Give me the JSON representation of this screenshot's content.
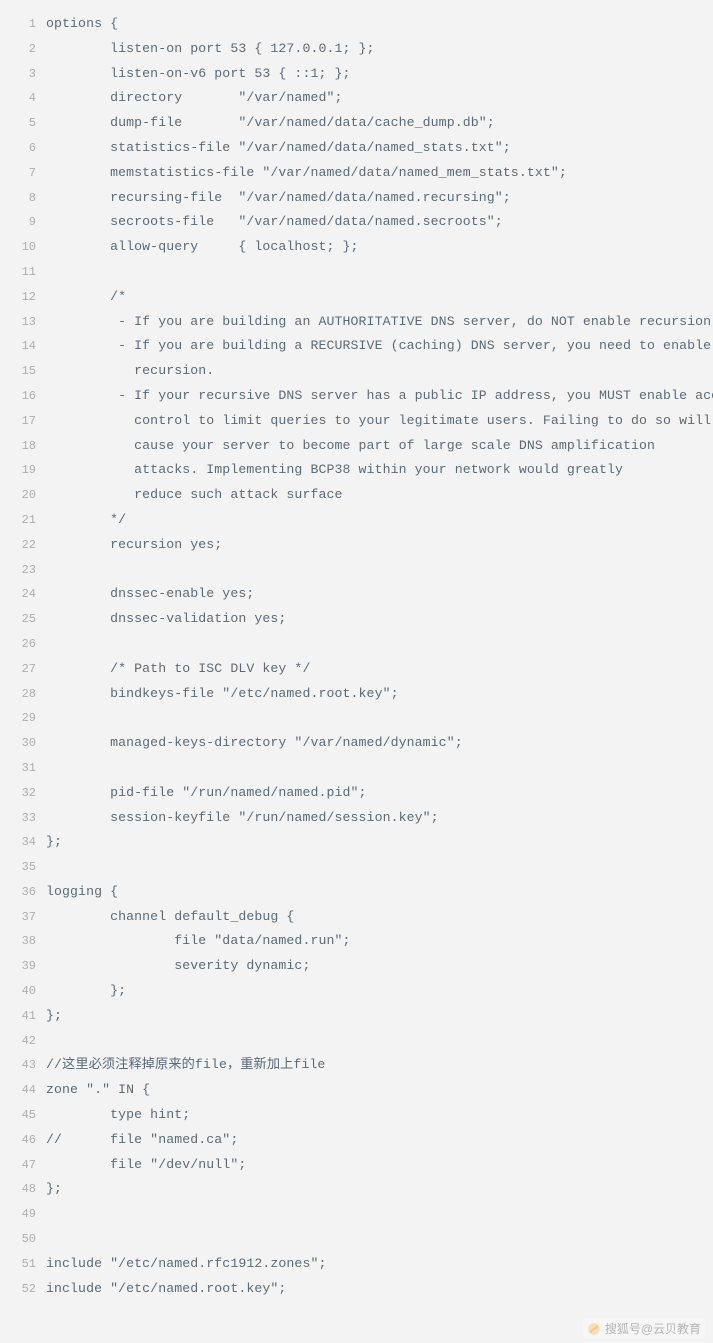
{
  "code": {
    "lines": [
      {
        "n": 1,
        "text": "options {"
      },
      {
        "n": 2,
        "text": "        listen-on port 53 { 127.0.0.1; };"
      },
      {
        "n": 3,
        "text": "        listen-on-v6 port 53 { ::1; };"
      },
      {
        "n": 4,
        "text": "        directory       \"/var/named\";"
      },
      {
        "n": 5,
        "text": "        dump-file       \"/var/named/data/cache_dump.db\";"
      },
      {
        "n": 6,
        "text": "        statistics-file \"/var/named/data/named_stats.txt\";"
      },
      {
        "n": 7,
        "text": "        memstatistics-file \"/var/named/data/named_mem_stats.txt\";"
      },
      {
        "n": 8,
        "text": "        recursing-file  \"/var/named/data/named.recursing\";"
      },
      {
        "n": 9,
        "text": "        secroots-file   \"/var/named/data/named.secroots\";"
      },
      {
        "n": 10,
        "text": "        allow-query     { localhost; };"
      },
      {
        "n": 11,
        "text": ""
      },
      {
        "n": 12,
        "text": "        /*"
      },
      {
        "n": 13,
        "text": "         - If you are building an AUTHORITATIVE DNS server, do NOT enable recursion."
      },
      {
        "n": 14,
        "text": "         - If you are building a RECURSIVE (caching) DNS server, you need to enable"
      },
      {
        "n": 15,
        "text": "           recursion."
      },
      {
        "n": 16,
        "text": "         - If your recursive DNS server has a public IP address, you MUST enable access"
      },
      {
        "n": 17,
        "text": "           control to limit queries to your legitimate users. Failing to do so will"
      },
      {
        "n": 18,
        "text": "           cause your server to become part of large scale DNS amplification"
      },
      {
        "n": 19,
        "text": "           attacks. Implementing BCP38 within your network would greatly"
      },
      {
        "n": 20,
        "text": "           reduce such attack surface"
      },
      {
        "n": 21,
        "text": "        */"
      },
      {
        "n": 22,
        "text": "        recursion yes;"
      },
      {
        "n": 23,
        "text": ""
      },
      {
        "n": 24,
        "text": "        dnssec-enable yes;"
      },
      {
        "n": 25,
        "text": "        dnssec-validation yes;"
      },
      {
        "n": 26,
        "text": ""
      },
      {
        "n": 27,
        "text": "        /* Path to ISC DLV key */"
      },
      {
        "n": 28,
        "text": "        bindkeys-file \"/etc/named.root.key\";"
      },
      {
        "n": 29,
        "text": ""
      },
      {
        "n": 30,
        "text": "        managed-keys-directory \"/var/named/dynamic\";"
      },
      {
        "n": 31,
        "text": ""
      },
      {
        "n": 32,
        "text": "        pid-file \"/run/named/named.pid\";"
      },
      {
        "n": 33,
        "text": "        session-keyfile \"/run/named/session.key\";"
      },
      {
        "n": 34,
        "text": "};"
      },
      {
        "n": 35,
        "text": ""
      },
      {
        "n": 36,
        "text": "logging {"
      },
      {
        "n": 37,
        "text": "        channel default_debug {"
      },
      {
        "n": 38,
        "text": "                file \"data/named.run\";"
      },
      {
        "n": 39,
        "text": "                severity dynamic;"
      },
      {
        "n": 40,
        "text": "        };"
      },
      {
        "n": 41,
        "text": "};"
      },
      {
        "n": 42,
        "text": ""
      },
      {
        "n": 43,
        "text": "//这里必须注释掉原来的file，重新加上file"
      },
      {
        "n": 44,
        "text": "zone \".\" IN {"
      },
      {
        "n": 45,
        "text": "        type hint;"
      },
      {
        "n": 46,
        "text": "//      file \"named.ca\";"
      },
      {
        "n": 47,
        "text": "        file \"/dev/null\";"
      },
      {
        "n": 48,
        "text": "};"
      },
      {
        "n": 49,
        "text": ""
      },
      {
        "n": 50,
        "text": ""
      },
      {
        "n": 51,
        "text": "include \"/etc/named.rfc1912.zones\";"
      },
      {
        "n": 52,
        "text": "include \"/etc/named.root.key\";"
      }
    ]
  },
  "watermark": {
    "text": "搜狐号@云贝教育"
  }
}
